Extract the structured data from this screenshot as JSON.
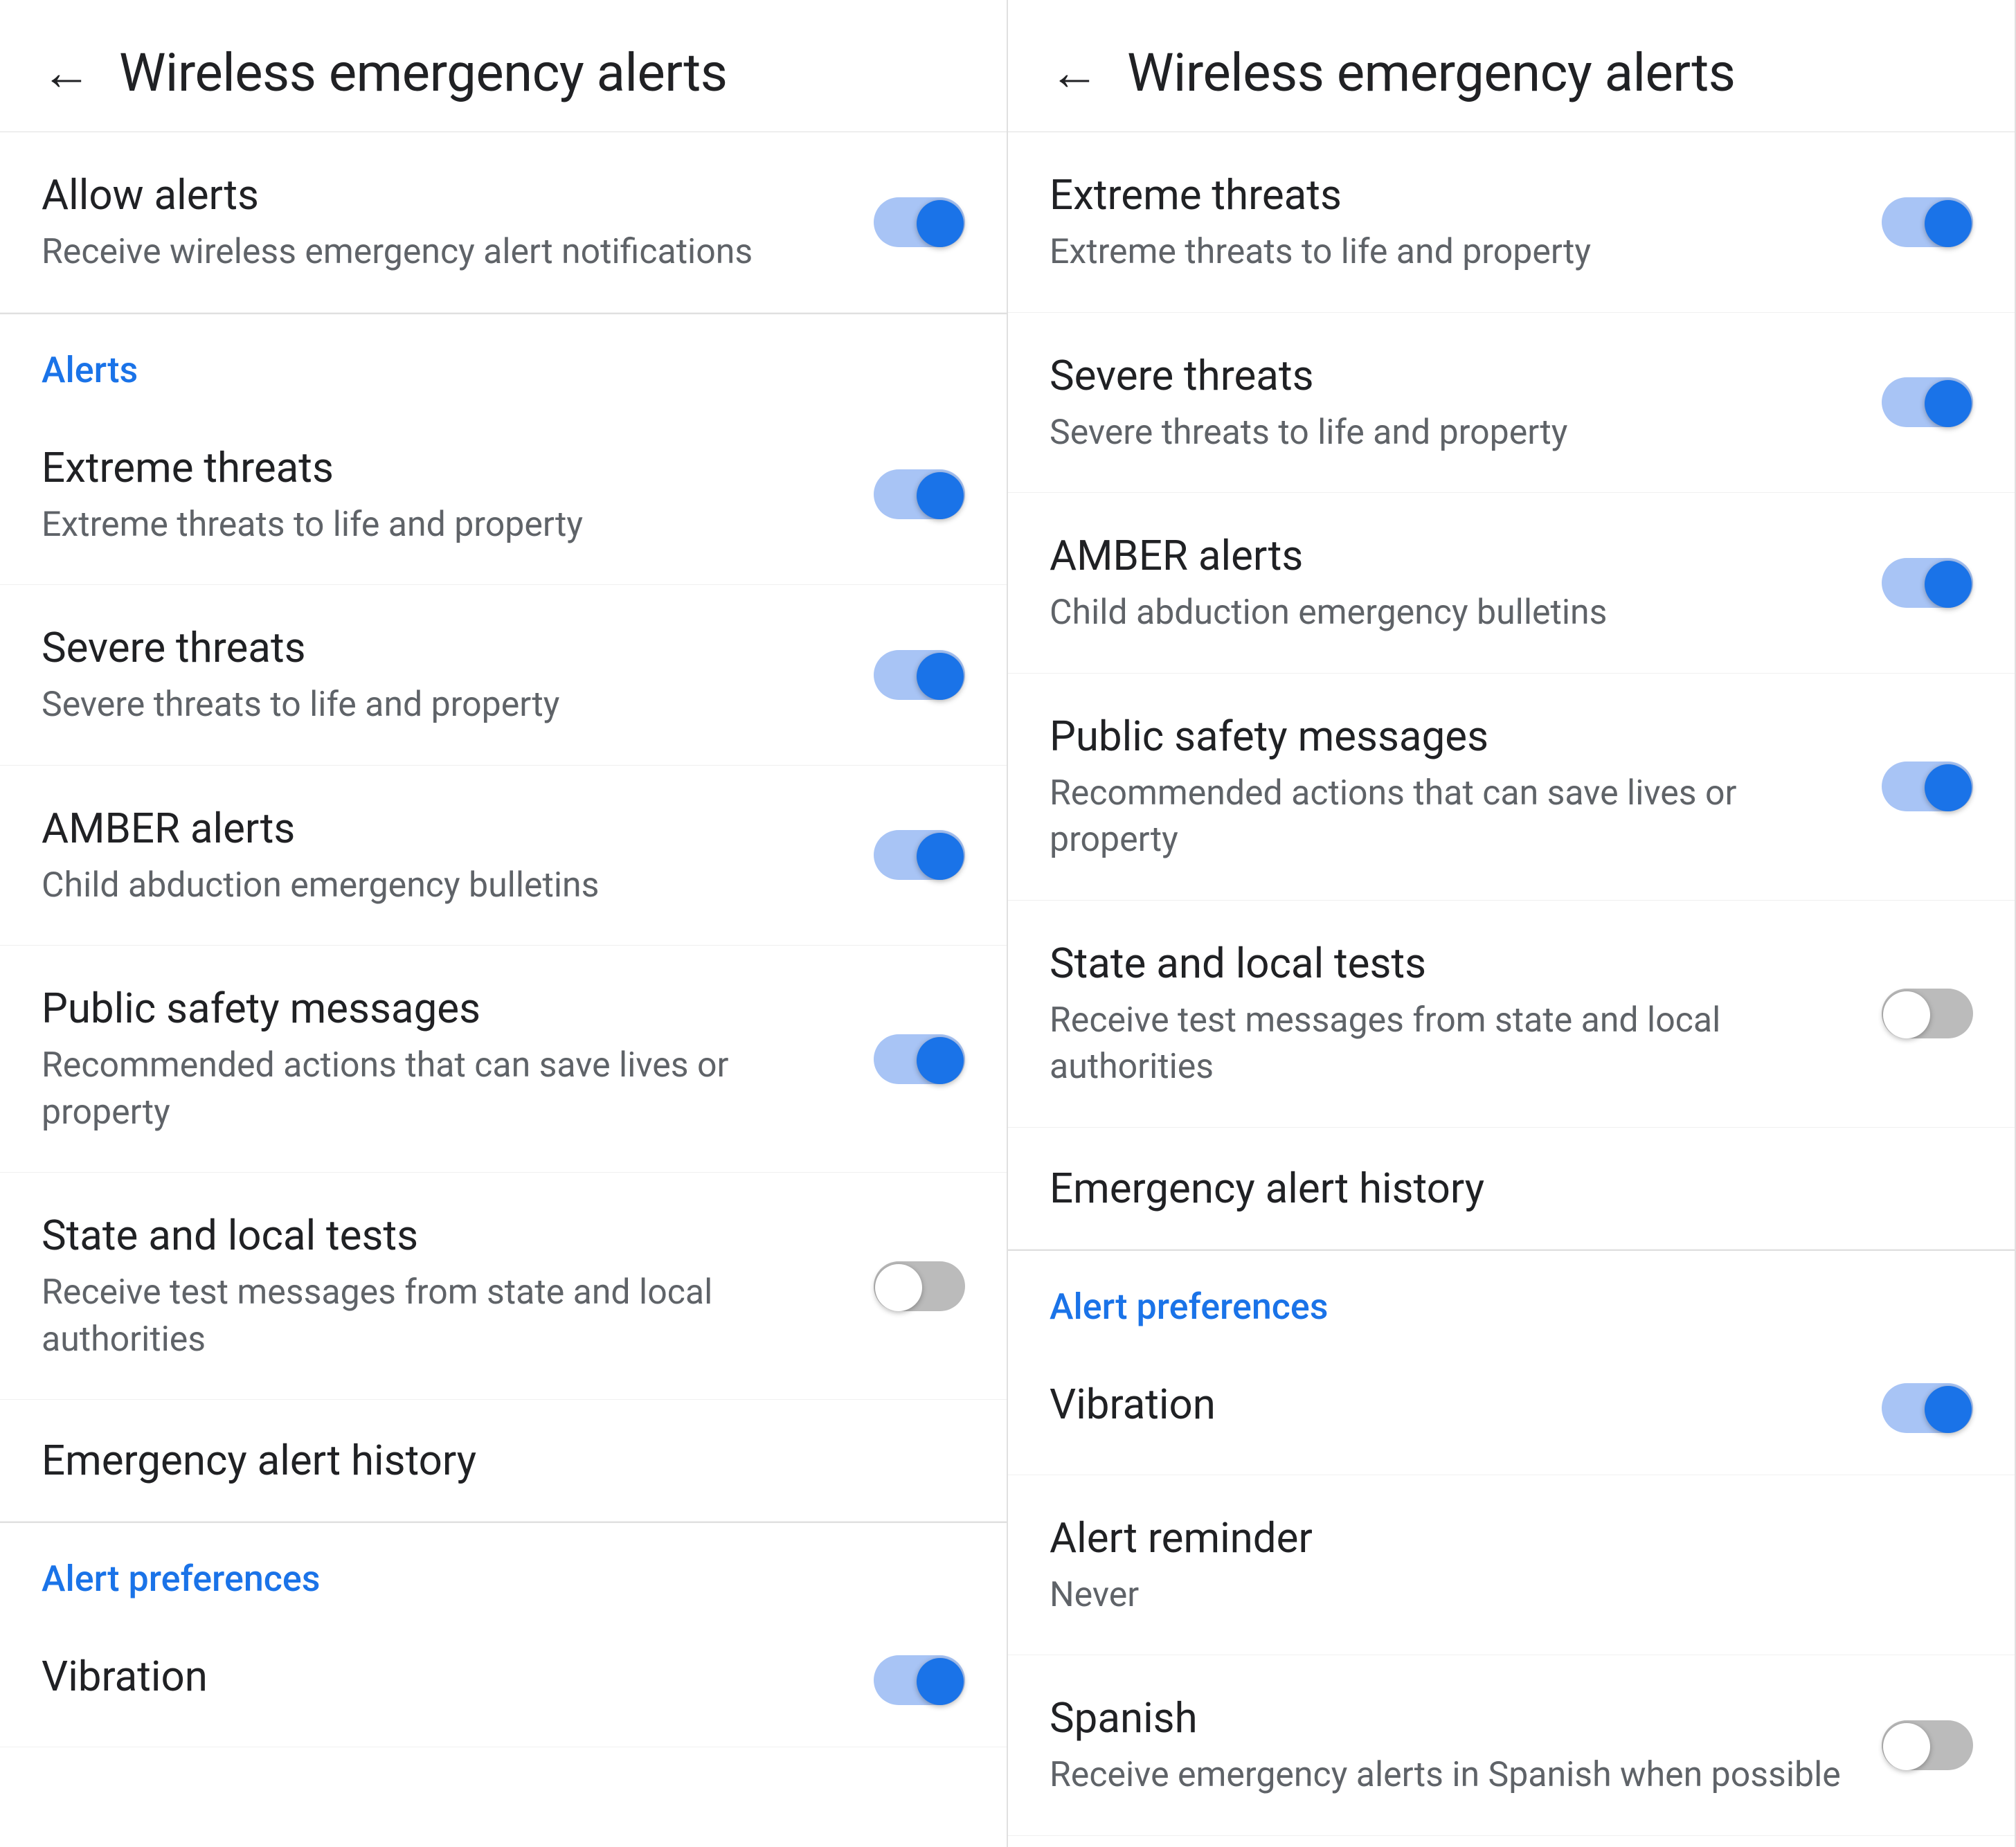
{
  "panels": [
    {
      "id": "panel-left",
      "header": {
        "back_label": "←",
        "title": "Wireless emergency alerts"
      },
      "sections": [
        {
          "id": "allow-alerts-section",
          "items": [
            {
              "id": "allow-alerts",
              "title": "Allow alerts",
              "subtitle": "Receive wireless emergency alert notifications",
              "has_toggle": true,
              "toggle_on": true
            }
          ]
        },
        {
          "id": "alerts-section",
          "section_label": "Alerts",
          "items": [
            {
              "id": "extreme-threats",
              "title": "Extreme threats",
              "subtitle": "Extreme threats to life and property",
              "has_toggle": true,
              "toggle_on": true
            },
            {
              "id": "severe-threats",
              "title": "Severe threats",
              "subtitle": "Severe threats to life and property",
              "has_toggle": true,
              "toggle_on": true
            },
            {
              "id": "amber-alerts",
              "title": "AMBER alerts",
              "subtitle": "Child abduction emergency bulletins",
              "has_toggle": true,
              "toggle_on": true
            },
            {
              "id": "public-safety",
              "title": "Public safety messages",
              "subtitle": "Recommended actions that can save lives or property",
              "has_toggle": true,
              "toggle_on": true
            },
            {
              "id": "state-local-tests",
              "title": "State and local tests",
              "subtitle": "Receive test messages from state and local authorities",
              "has_toggle": true,
              "toggle_on": false
            },
            {
              "id": "emergency-history",
              "title": "Emergency alert history",
              "subtitle": null,
              "has_toggle": false,
              "toggle_on": false
            }
          ]
        },
        {
          "id": "alert-preferences-section",
          "section_label": "Alert preferences",
          "items": [
            {
              "id": "vibration",
              "title": "Vibration",
              "subtitle": null,
              "has_toggle": true,
              "toggle_on": true
            }
          ]
        }
      ]
    },
    {
      "id": "panel-right",
      "header": {
        "back_label": "←",
        "title": "Wireless emergency alerts"
      },
      "sections": [
        {
          "id": "alerts-section-right",
          "items": [
            {
              "id": "extreme-threats-r",
              "title": "Extreme threats",
              "subtitle": "Extreme threats to life and property",
              "has_toggle": true,
              "toggle_on": true
            },
            {
              "id": "severe-threats-r",
              "title": "Severe threats",
              "subtitle": "Severe threats to life and property",
              "has_toggle": true,
              "toggle_on": true
            },
            {
              "id": "amber-alerts-r",
              "title": "AMBER alerts",
              "subtitle": "Child abduction emergency bulletins",
              "has_toggle": true,
              "toggle_on": true
            },
            {
              "id": "public-safety-r",
              "title": "Public safety messages",
              "subtitle": "Recommended actions that can save lives or property",
              "has_toggle": true,
              "toggle_on": true
            },
            {
              "id": "state-local-tests-r",
              "title": "State and local tests",
              "subtitle": "Receive test messages from state and local authorities",
              "has_toggle": true,
              "toggle_on": false
            },
            {
              "id": "emergency-history-r",
              "title": "Emergency alert history",
              "subtitle": null,
              "has_toggle": false,
              "toggle_on": false
            }
          ]
        },
        {
          "id": "alert-prefs-section-right",
          "section_label": "Alert preferences",
          "items": [
            {
              "id": "vibration-r",
              "title": "Vibration",
              "subtitle": null,
              "has_toggle": true,
              "toggle_on": true
            },
            {
              "id": "alert-reminder-r",
              "title": "Alert reminder",
              "subtitle": "Never",
              "has_toggle": false,
              "toggle_on": false
            },
            {
              "id": "spanish-r",
              "title": "Spanish",
              "subtitle": "Receive emergency alerts in Spanish when possible",
              "has_toggle": true,
              "toggle_on": false
            }
          ]
        }
      ]
    }
  ]
}
